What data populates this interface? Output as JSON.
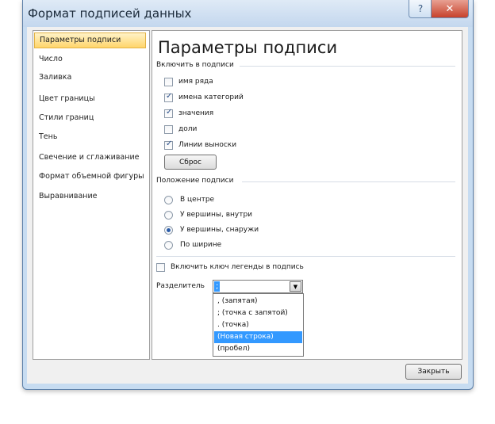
{
  "window": {
    "title": "Формат подписей данных",
    "help_glyph": "?",
    "close_glyph": "✕",
    "close_label": "Закрыть"
  },
  "nav": {
    "items": [
      {
        "label": "Параметры подписи",
        "selected": true
      },
      {
        "label": "Число"
      },
      {
        "label": "Заливка"
      },
      {
        "label": "Цвет границы"
      },
      {
        "label": "Стили границ"
      },
      {
        "label": "Тень"
      },
      {
        "label": "Свечение и сглаживание"
      },
      {
        "label": "Формат объемной фигуры"
      },
      {
        "label": "Выравнивание"
      }
    ]
  },
  "main": {
    "heading": "Параметры подписи",
    "include_group": {
      "label": "Включить в подписи",
      "options": [
        {
          "label": "имя ряда",
          "checked": false
        },
        {
          "label": "имена категорий",
          "checked": true
        },
        {
          "label": "значения",
          "checked": true
        },
        {
          "label": "доли",
          "checked": false
        },
        {
          "label": "Линии выноски",
          "checked": true
        }
      ],
      "reset_label": "Сброс"
    },
    "position_group": {
      "label": "Положение подписи",
      "options": [
        {
          "label": "В центре",
          "selected": false
        },
        {
          "label": "У вершины, внутри",
          "selected": false
        },
        {
          "label": "У вершины, снаружи",
          "selected": true
        },
        {
          "label": "По ширине",
          "selected": false
        }
      ]
    },
    "legend_key": {
      "label": "Включить ключ легенды в подпись",
      "checked": false
    },
    "separator": {
      "label": "Разделитель",
      "value": ";",
      "options": [
        {
          "label": ", (запятая)"
        },
        {
          "label": "; (точка с запятой)"
        },
        {
          "label": ". (точка)"
        },
        {
          "label": "(Новая строка)",
          "highlighted": true
        },
        {
          "label": "(пробел)"
        }
      ]
    }
  },
  "colors": {
    "selection": "#3399ff",
    "nav_selected": "#ffd56b",
    "close_button": "#c7412b"
  }
}
